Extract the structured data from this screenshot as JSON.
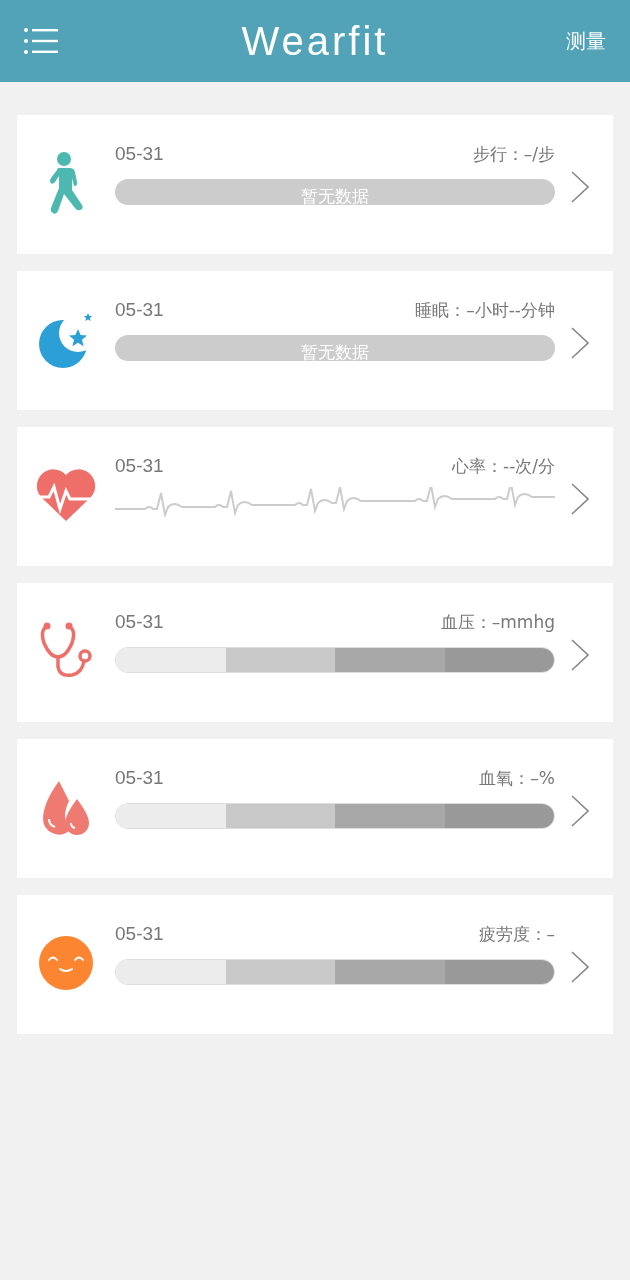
{
  "header": {
    "title": "Wearfit",
    "action": "测量"
  },
  "cards": [
    {
      "kind": "empty",
      "date": "05-31",
      "reading": "步行：–/步",
      "note": "暂无数据"
    },
    {
      "kind": "empty",
      "date": "05-31",
      "reading": "睡眠：–小时--分钟",
      "note": "暂无数据"
    },
    {
      "kind": "wave",
      "date": "05-31",
      "reading": "心率：--次/分"
    },
    {
      "kind": "scale",
      "date": "05-31",
      "reading": "血压：–mmhg"
    },
    {
      "kind": "scale",
      "date": "05-31",
      "reading": "血氧：–%"
    },
    {
      "kind": "scale",
      "date": "05-31",
      "reading": "疲劳度：–"
    }
  ]
}
